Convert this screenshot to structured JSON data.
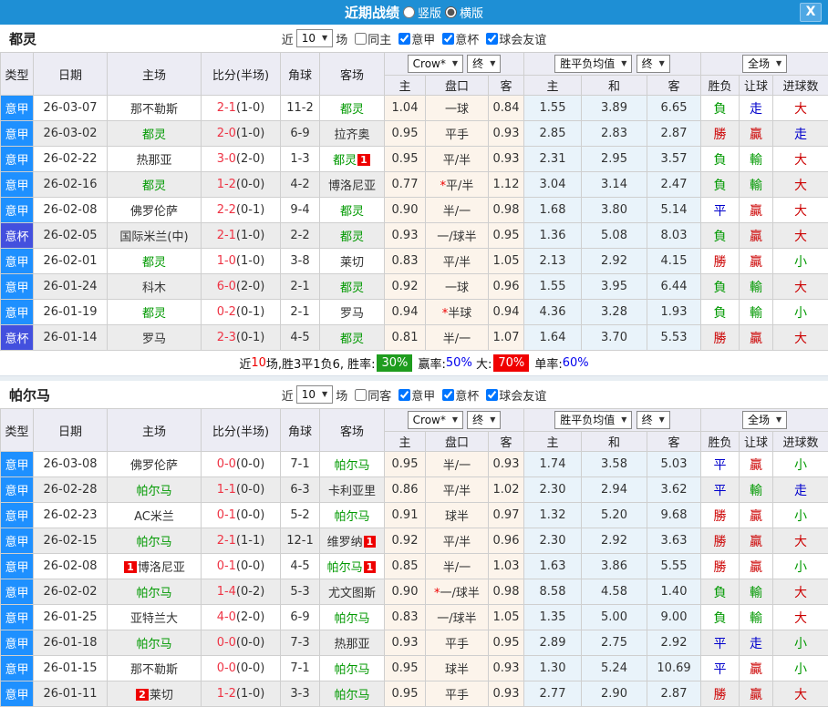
{
  "titlebar": {
    "title": "近期战绩",
    "radios": [
      {
        "label": "竖版",
        "checked": false
      },
      {
        "label": "横版",
        "checked": true
      }
    ],
    "close": "X"
  },
  "colors": {
    "titlebar_bg": "#1E8FD5",
    "league_serie_a": "#1E90FF",
    "league_cup": "#4350DE",
    "focal_team": "#009900",
    "score_ft": "#EE3344",
    "win_red": "#CC0000",
    "loss_green": "#009900",
    "draw_blue": "#0000CC",
    "odds_bg": "#FCF4EB",
    "avg_bg": "#E9F3FA",
    "header_bg": "#ECECF4"
  },
  "table_headers": {
    "left": [
      "类型",
      "日期",
      "主场",
      "比分(半场)",
      "角球",
      "客场"
    ],
    "sub": [
      "主",
      "盘口",
      "客",
      "主",
      "和",
      "客",
      "胜负",
      "让球",
      "进球数"
    ],
    "selects": [
      "Crow*",
      "终",
      "胜平负均值",
      "终",
      "全场"
    ]
  },
  "sections": [
    {
      "team": "都灵",
      "filter": {
        "prefix": "近",
        "count": "10",
        "suffix": "场",
        "same": {
          "label": "同主",
          "checked": false
        },
        "leagues": [
          {
            "label": "意甲",
            "checked": true
          },
          {
            "label": "意杯",
            "checked": true
          },
          {
            "label": "球会友谊",
            "checked": true
          }
        ]
      },
      "rows": [
        {
          "league": "意甲",
          "lg": "jia",
          "date": "26-03-07",
          "home": {
            "name": "那不勒斯",
            "focal": false,
            "b1": "",
            "b2": ""
          },
          "ft": "2-1",
          "ht": "(1-0)",
          "corner": "11-2",
          "away": {
            "name": "都灵",
            "focal": true,
            "b1": "",
            "b2": ""
          },
          "o1": "1.04",
          "hc": "一球",
          "star": false,
          "o2": "0.84",
          "avg": [
            "1.55",
            "3.89",
            "6.65"
          ],
          "res": [
            [
              "負",
              "green"
            ],
            [
              "走",
              "blue"
            ],
            [
              "大",
              "red"
            ]
          ]
        },
        {
          "league": "意甲",
          "lg": "jia",
          "date": "26-03-02",
          "home": {
            "name": "都灵",
            "focal": true,
            "b1": "",
            "b2": ""
          },
          "ft": "2-0",
          "ht": "(1-0)",
          "corner": "6-9",
          "away": {
            "name": "拉齐奥",
            "focal": false,
            "b1": "",
            "b2": ""
          },
          "o1": "0.95",
          "hc": "平手",
          "star": false,
          "o2": "0.93",
          "avg": [
            "2.85",
            "2.83",
            "2.87"
          ],
          "res": [
            [
              "勝",
              "red"
            ],
            [
              "贏",
              "red"
            ],
            [
              "走",
              "blue"
            ]
          ]
        },
        {
          "league": "意甲",
          "lg": "jia",
          "date": "26-02-22",
          "home": {
            "name": "热那亚",
            "focal": false,
            "b1": "",
            "b2": ""
          },
          "ft": "3-0",
          "ht": "(2-0)",
          "corner": "1-3",
          "away": {
            "name": "都灵",
            "focal": true,
            "b1": "",
            "b2": "1"
          },
          "o1": "0.95",
          "hc": "平/半",
          "star": false,
          "o2": "0.93",
          "avg": [
            "2.31",
            "2.95",
            "3.57"
          ],
          "res": [
            [
              "負",
              "green"
            ],
            [
              "輸",
              "green"
            ],
            [
              "大",
              "red"
            ]
          ]
        },
        {
          "league": "意甲",
          "lg": "jia",
          "date": "26-02-16",
          "home": {
            "name": "都灵",
            "focal": true,
            "b1": "",
            "b2": ""
          },
          "ft": "1-2",
          "ht": "(0-0)",
          "corner": "4-2",
          "away": {
            "name": "博洛尼亚",
            "focal": false,
            "b1": "",
            "b2": ""
          },
          "o1": "0.77",
          "hc": "平/半",
          "star": true,
          "o2": "1.12",
          "avg": [
            "3.04",
            "3.14",
            "2.47"
          ],
          "res": [
            [
              "負",
              "green"
            ],
            [
              "輸",
              "green"
            ],
            [
              "大",
              "red"
            ]
          ]
        },
        {
          "league": "意甲",
          "lg": "jia",
          "date": "26-02-08",
          "home": {
            "name": "佛罗伦萨",
            "focal": false,
            "b1": "",
            "b2": ""
          },
          "ft": "2-2",
          "ht": "(0-1)",
          "corner": "9-4",
          "away": {
            "name": "都灵",
            "focal": true,
            "b1": "",
            "b2": ""
          },
          "o1": "0.90",
          "hc": "半/一",
          "star": false,
          "o2": "0.98",
          "avg": [
            "1.68",
            "3.80",
            "5.14"
          ],
          "res": [
            [
              "平",
              "blue"
            ],
            [
              "贏",
              "red"
            ],
            [
              "大",
              "red"
            ]
          ]
        },
        {
          "league": "意杯",
          "lg": "bei",
          "date": "26-02-05",
          "home": {
            "name": "国际米兰(中)",
            "focal": false,
            "b1": "",
            "b2": ""
          },
          "ft": "2-1",
          "ht": "(1-0)",
          "corner": "2-2",
          "away": {
            "name": "都灵",
            "focal": true,
            "b1": "",
            "b2": ""
          },
          "o1": "0.93",
          "hc": "一/球半",
          "star": false,
          "o2": "0.95",
          "avg": [
            "1.36",
            "5.08",
            "8.03"
          ],
          "res": [
            [
              "負",
              "green"
            ],
            [
              "贏",
              "red"
            ],
            [
              "大",
              "red"
            ]
          ]
        },
        {
          "league": "意甲",
          "lg": "jia",
          "date": "26-02-01",
          "home": {
            "name": "都灵",
            "focal": true,
            "b1": "",
            "b2": ""
          },
          "ft": "1-0",
          "ht": "(1-0)",
          "corner": "3-8",
          "away": {
            "name": "莱切",
            "focal": false,
            "b1": "",
            "b2": ""
          },
          "o1": "0.83",
          "hc": "平/半",
          "star": false,
          "o2": "1.05",
          "avg": [
            "2.13",
            "2.92",
            "4.15"
          ],
          "res": [
            [
              "勝",
              "red"
            ],
            [
              "贏",
              "red"
            ],
            [
              "小",
              "green"
            ]
          ]
        },
        {
          "league": "意甲",
          "lg": "jia",
          "date": "26-01-24",
          "home": {
            "name": "科木",
            "focal": false,
            "b1": "",
            "b2": ""
          },
          "ft": "6-0",
          "ht": "(2-0)",
          "corner": "2-1",
          "away": {
            "name": "都灵",
            "focal": true,
            "b1": "",
            "b2": ""
          },
          "o1": "0.92",
          "hc": "一球",
          "star": false,
          "o2": "0.96",
          "avg": [
            "1.55",
            "3.95",
            "6.44"
          ],
          "res": [
            [
              "負",
              "green"
            ],
            [
              "輸",
              "green"
            ],
            [
              "大",
              "red"
            ]
          ]
        },
        {
          "league": "意甲",
          "lg": "jia",
          "date": "26-01-19",
          "home": {
            "name": "都灵",
            "focal": true,
            "b1": "",
            "b2": ""
          },
          "ft": "0-2",
          "ht": "(0-1)",
          "corner": "2-1",
          "away": {
            "name": "罗马",
            "focal": false,
            "b1": "",
            "b2": ""
          },
          "o1": "0.94",
          "hc": "半球",
          "star": true,
          "o2": "0.94",
          "avg": [
            "4.36",
            "3.28",
            "1.93"
          ],
          "res": [
            [
              "負",
              "green"
            ],
            [
              "輸",
              "green"
            ],
            [
              "小",
              "green"
            ]
          ]
        },
        {
          "league": "意杯",
          "lg": "bei",
          "date": "26-01-14",
          "home": {
            "name": "罗马",
            "focal": false,
            "b1": "",
            "b2": ""
          },
          "ft": "2-3",
          "ht": "(0-1)",
          "corner": "4-5",
          "away": {
            "name": "都灵",
            "focal": true,
            "b1": "",
            "b2": ""
          },
          "o1": "0.81",
          "hc": "半/一",
          "star": false,
          "o2": "1.07",
          "avg": [
            "1.64",
            "3.70",
            "5.53"
          ],
          "res": [
            [
              "勝",
              "red"
            ],
            [
              "贏",
              "red"
            ],
            [
              "大",
              "red"
            ]
          ]
        }
      ],
      "summary": [
        {
          "t": "近",
          "cls": ""
        },
        {
          "t": "10",
          "cls": "s-red"
        },
        {
          "t": "场,胜3平1负6, 胜率:",
          "cls": ""
        },
        {
          "t": "30%",
          "cls": "s-bg-green"
        },
        {
          "t": " 赢率:",
          "cls": ""
        },
        {
          "t": "50%",
          "cls": "s-blue"
        },
        {
          "t": " 大:",
          "cls": ""
        },
        {
          "t": "70%",
          "cls": "s-bg-red"
        },
        {
          "t": " 单率:",
          "cls": ""
        },
        {
          "t": "60%",
          "cls": "s-blue"
        }
      ]
    },
    {
      "team": "帕尔马",
      "filter": {
        "prefix": "近",
        "count": "10",
        "suffix": "场",
        "same": {
          "label": "同客",
          "checked": false
        },
        "leagues": [
          {
            "label": "意甲",
            "checked": true
          },
          {
            "label": "意杯",
            "checked": true
          },
          {
            "label": "球会友谊",
            "checked": true
          }
        ]
      },
      "rows": [
        {
          "league": "意甲",
          "lg": "jia",
          "date": "26-03-08",
          "home": {
            "name": "佛罗伦萨",
            "focal": false,
            "b1": "",
            "b2": ""
          },
          "ft": "0-0",
          "ht": "(0-0)",
          "corner": "7-1",
          "away": {
            "name": "帕尔马",
            "focal": true,
            "b1": "",
            "b2": ""
          },
          "o1": "0.95",
          "hc": "半/一",
          "star": false,
          "o2": "0.93",
          "avg": [
            "1.74",
            "3.58",
            "5.03"
          ],
          "res": [
            [
              "平",
              "blue"
            ],
            [
              "贏",
              "red"
            ],
            [
              "小",
              "green"
            ]
          ]
        },
        {
          "league": "意甲",
          "lg": "jia",
          "date": "26-02-28",
          "home": {
            "name": "帕尔马",
            "focal": true,
            "b1": "",
            "b2": ""
          },
          "ft": "1-1",
          "ht": "(0-0)",
          "corner": "6-3",
          "away": {
            "name": "卡利亚里",
            "focal": false,
            "b1": "",
            "b2": ""
          },
          "o1": "0.86",
          "hc": "平/半",
          "star": false,
          "o2": "1.02",
          "avg": [
            "2.30",
            "2.94",
            "3.62"
          ],
          "res": [
            [
              "平",
              "blue"
            ],
            [
              "輸",
              "green"
            ],
            [
              "走",
              "blue"
            ]
          ]
        },
        {
          "league": "意甲",
          "lg": "jia",
          "date": "26-02-23",
          "home": {
            "name": "AC米兰",
            "focal": false,
            "b1": "",
            "b2": ""
          },
          "ft": "0-1",
          "ht": "(0-0)",
          "corner": "5-2",
          "away": {
            "name": "帕尔马",
            "focal": true,
            "b1": "",
            "b2": ""
          },
          "o1": "0.91",
          "hc": "球半",
          "star": false,
          "o2": "0.97",
          "avg": [
            "1.32",
            "5.20",
            "9.68"
          ],
          "res": [
            [
              "勝",
              "red"
            ],
            [
              "贏",
              "red"
            ],
            [
              "小",
              "green"
            ]
          ]
        },
        {
          "league": "意甲",
          "lg": "jia",
          "date": "26-02-15",
          "home": {
            "name": "帕尔马",
            "focal": true,
            "b1": "",
            "b2": ""
          },
          "ft": "2-1",
          "ht": "(1-1)",
          "corner": "12-1",
          "away": {
            "name": "维罗纳",
            "focal": false,
            "b1": "",
            "b2": "1"
          },
          "o1": "0.92",
          "hc": "平/半",
          "star": false,
          "o2": "0.96",
          "avg": [
            "2.30",
            "2.92",
            "3.63"
          ],
          "res": [
            [
              "勝",
              "red"
            ],
            [
              "贏",
              "red"
            ],
            [
              "大",
              "red"
            ]
          ]
        },
        {
          "league": "意甲",
          "lg": "jia",
          "date": "26-02-08",
          "home": {
            "name": "博洛尼亚",
            "focal": false,
            "b1": "1",
            "b2": ""
          },
          "ft": "0-1",
          "ht": "(0-0)",
          "corner": "4-5",
          "away": {
            "name": "帕尔马",
            "focal": true,
            "b1": "",
            "b2": "1"
          },
          "o1": "0.85",
          "hc": "半/一",
          "star": false,
          "o2": "1.03",
          "avg": [
            "1.63",
            "3.86",
            "5.55"
          ],
          "res": [
            [
              "勝",
              "red"
            ],
            [
              "贏",
              "red"
            ],
            [
              "小",
              "green"
            ]
          ]
        },
        {
          "league": "意甲",
          "lg": "jia",
          "date": "26-02-02",
          "home": {
            "name": "帕尔马",
            "focal": true,
            "b1": "",
            "b2": ""
          },
          "ft": "1-4",
          "ht": "(0-2)",
          "corner": "5-3",
          "away": {
            "name": "尤文图斯",
            "focal": false,
            "b1": "",
            "b2": ""
          },
          "o1": "0.90",
          "hc": "一/球半",
          "star": true,
          "o2": "0.98",
          "avg": [
            "8.58",
            "4.58",
            "1.40"
          ],
          "res": [
            [
              "負",
              "green"
            ],
            [
              "輸",
              "green"
            ],
            [
              "大",
              "red"
            ]
          ]
        },
        {
          "league": "意甲",
          "lg": "jia",
          "date": "26-01-25",
          "home": {
            "name": "亚特兰大",
            "focal": false,
            "b1": "",
            "b2": ""
          },
          "ft": "4-0",
          "ht": "(2-0)",
          "corner": "6-9",
          "away": {
            "name": "帕尔马",
            "focal": true,
            "b1": "",
            "b2": ""
          },
          "o1": "0.83",
          "hc": "一/球半",
          "star": false,
          "o2": "1.05",
          "avg": [
            "1.35",
            "5.00",
            "9.00"
          ],
          "res": [
            [
              "負",
              "green"
            ],
            [
              "輸",
              "green"
            ],
            [
              "大",
              "red"
            ]
          ]
        },
        {
          "league": "意甲",
          "lg": "jia",
          "date": "26-01-18",
          "home": {
            "name": "帕尔马",
            "focal": true,
            "b1": "",
            "b2": ""
          },
          "ft": "0-0",
          "ht": "(0-0)",
          "corner": "7-3",
          "away": {
            "name": "热那亚",
            "focal": false,
            "b1": "",
            "b2": ""
          },
          "o1": "0.93",
          "hc": "平手",
          "star": false,
          "o2": "0.95",
          "avg": [
            "2.89",
            "2.75",
            "2.92"
          ],
          "res": [
            [
              "平",
              "blue"
            ],
            [
              "走",
              "blue"
            ],
            [
              "小",
              "green"
            ]
          ]
        },
        {
          "league": "意甲",
          "lg": "jia",
          "date": "26-01-15",
          "home": {
            "name": "那不勒斯",
            "focal": false,
            "b1": "",
            "b2": ""
          },
          "ft": "0-0",
          "ht": "(0-0)",
          "corner": "7-1",
          "away": {
            "name": "帕尔马",
            "focal": true,
            "b1": "",
            "b2": ""
          },
          "o1": "0.95",
          "hc": "球半",
          "star": false,
          "o2": "0.93",
          "avg": [
            "1.30",
            "5.24",
            "10.69"
          ],
          "res": [
            [
              "平",
              "blue"
            ],
            [
              "贏",
              "red"
            ],
            [
              "小",
              "green"
            ]
          ]
        },
        {
          "league": "意甲",
          "lg": "jia",
          "date": "26-01-11",
          "home": {
            "name": "莱切",
            "focal": false,
            "b1": "2",
            "b2": ""
          },
          "ft": "1-2",
          "ht": "(1-0)",
          "corner": "3-3",
          "away": {
            "name": "帕尔马",
            "focal": true,
            "b1": "",
            "b2": ""
          },
          "o1": "0.95",
          "hc": "平手",
          "star": false,
          "o2": "0.93",
          "avg": [
            "2.77",
            "2.90",
            "2.87"
          ],
          "res": [
            [
              "勝",
              "red"
            ],
            [
              "贏",
              "red"
            ],
            [
              "大",
              "red"
            ]
          ]
        }
      ],
      "summary": null
    }
  ]
}
